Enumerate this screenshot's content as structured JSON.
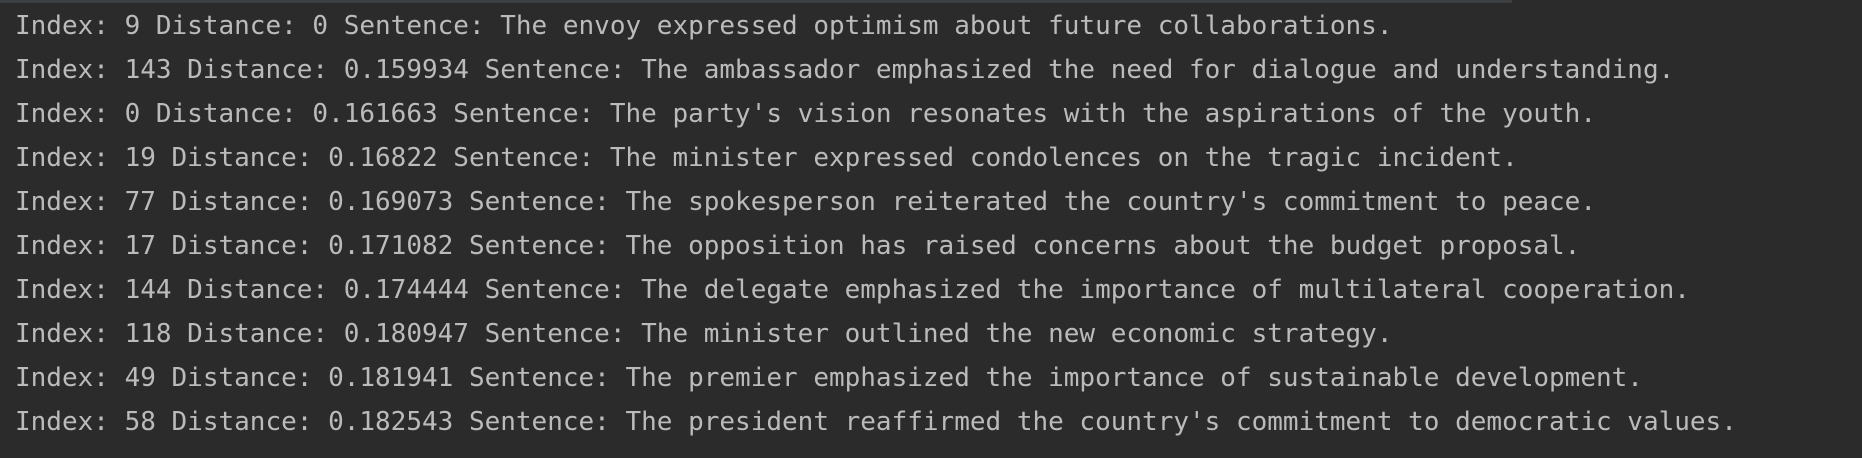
{
  "console": {
    "lines": [
      "Index: 9 Distance: 0 Sentence: The envoy expressed optimism about future collaborations.",
      "Index: 143 Distance: 0.159934 Sentence: The ambassador emphasized the need for dialogue and understanding.",
      "Index: 0 Distance: 0.161663 Sentence: The party's vision resonates with the aspirations of the youth.",
      "Index: 19 Distance: 0.16822 Sentence: The minister expressed condolences on the tragic incident.",
      "Index: 77 Distance: 0.169073 Sentence: The spokesperson reiterated the country's commitment to peace.",
      "Index: 17 Distance: 0.171082 Sentence: The opposition has raised concerns about the budget proposal.",
      "Index: 144 Distance: 0.174444 Sentence: The delegate emphasized the importance of multilateral cooperation.",
      "Index: 118 Distance: 0.180947 Sentence: The minister outlined the new economic strategy.",
      "Index: 49 Distance: 0.181941 Sentence: The premier emphasized the importance of sustainable development.",
      "Index: 58 Distance: 0.182543 Sentence: The president reaffirmed the country's commitment to democratic values."
    ]
  },
  "colors": {
    "background": "#2b2b2b",
    "text": "#bbbbbb",
    "scroll_indicator": "#3c3f41"
  }
}
